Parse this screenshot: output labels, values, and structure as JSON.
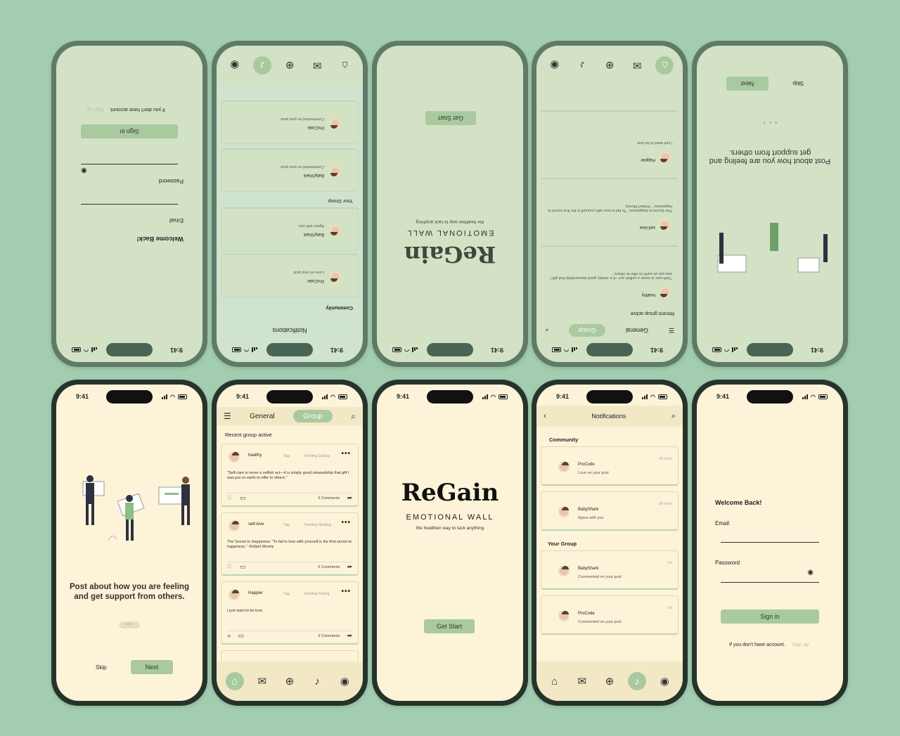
{
  "status": {
    "time": "9:41"
  },
  "onboarding": {
    "headline": "Post about how you are feeling and get support from others.",
    "skip": "Skip",
    "next": "Next",
    "dots": "• • •"
  },
  "feed": {
    "tabs": {
      "general": "General",
      "group": "Group"
    },
    "section_title": "Recent group active",
    "posts": [
      {
        "user": "healthy",
        "tag": "Tag",
        "feeling": "Feeling Caring",
        "text": "\"Self-care is never a selfish act—it is simply good stewardship that gift I was put on earth to offer to others.\"",
        "comments": "3 Comments"
      },
      {
        "user": "self-love",
        "tag": "Tag",
        "feeling": "Feeling Healing",
        "text": "The Secret to Happiness: \"To fall in love with yourself is the first secret to happiness.\" -Robert Morely",
        "comments": "5 Comments"
      },
      {
        "user": "Happier",
        "tag": "Tag",
        "feeling": "Feeling Crying",
        "text": "I just want to be love",
        "comments": "3 Comments"
      }
    ],
    "more": "•••"
  },
  "splash": {
    "logo": "ReGain",
    "subtitle": "EMOTIONAL WALL",
    "tagline": "the healthier way to tack anything",
    "cta": "Get Start"
  },
  "notifications": {
    "title": "Notifications",
    "community_title": "Community",
    "group_title": "Your Group",
    "community": [
      {
        "name": "ProCode",
        "msg": "Love on your post",
        "time": "30 mins"
      },
      {
        "name": "BabyShark",
        "msg": "Agree with you",
        "time": "30 mins"
      }
    ],
    "group": [
      {
        "name": "BabyShark",
        "msg": "Commented on your post",
        "time": "1w"
      },
      {
        "name": "ProCode",
        "msg": "Commented on your post",
        "time": "1w"
      }
    ]
  },
  "login": {
    "title": "Welcome Back!",
    "email_label": "Email",
    "password_label": "Password",
    "signin": "Sign in",
    "no_account": "If you don't have account.",
    "signup": "Sign up"
  },
  "colors": {
    "background": "#a3cdb1",
    "cream": "#fdf3d8",
    "accent": "#a9ca9f",
    "mint": "#d3e2c5"
  }
}
